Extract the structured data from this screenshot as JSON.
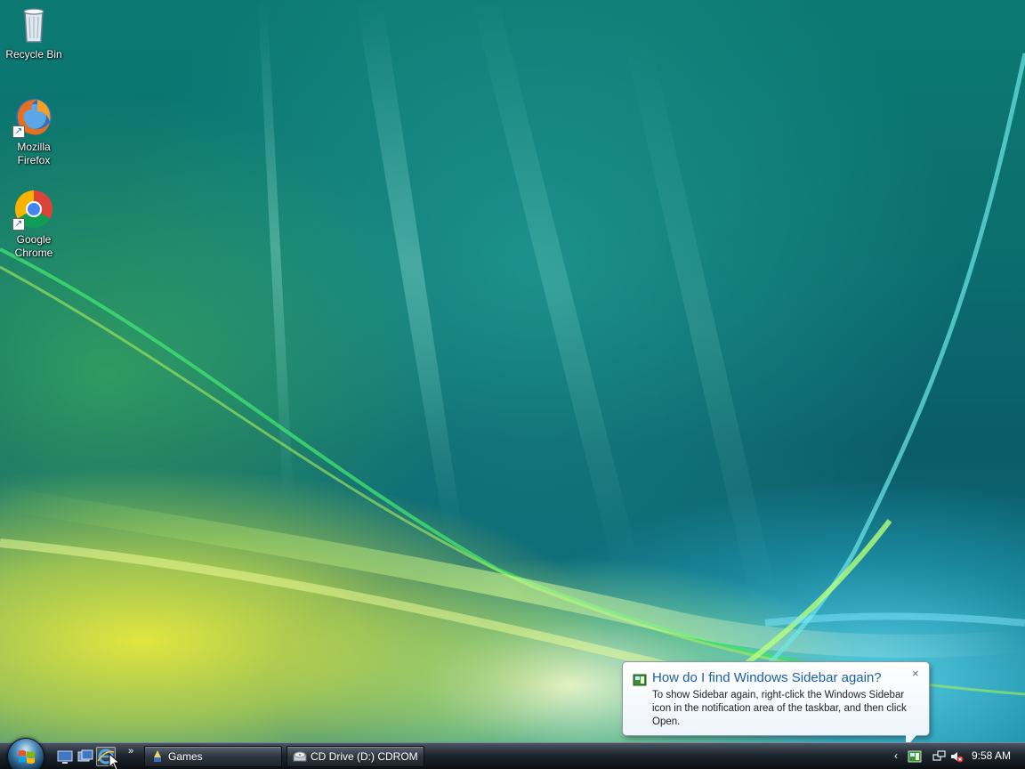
{
  "desktop": {
    "icons": [
      {
        "label": "Recycle Bin",
        "icon": "recycle-bin-icon"
      },
      {
        "label": "Mozilla Firefox",
        "icon": "firefox-icon",
        "shortcut": true
      },
      {
        "label": "Google Chrome",
        "icon": "chrome-icon",
        "shortcut": true
      }
    ]
  },
  "taskbar": {
    "start_icon": "windows-start-orb",
    "quicklaunch": [
      {
        "icon": "show-desktop-icon"
      },
      {
        "icon": "switch-windows-icon"
      },
      {
        "icon": "internet-explorer-icon",
        "active": true
      }
    ],
    "more": "»",
    "tasks": [
      {
        "label": "Games",
        "icon": "games-folder-icon"
      },
      {
        "label": "CD Drive (D:) CDROM",
        "icon": "cd-drive-icon"
      }
    ],
    "tray": {
      "expand": "‹",
      "icons": [
        "windows-sidebar-icon",
        "network-icon",
        "volume-muted-icon"
      ],
      "clock": "9:58 AM"
    }
  },
  "balloon": {
    "title": "How do I find Windows Sidebar again?",
    "text": "To show Sidebar again, right-click the Windows Sidebar icon in the notification area of the taskbar, and then click Open.",
    "close": "×"
  },
  "colors": {
    "balloon_title": "#1b5fa8",
    "taskbar": "#1f262e"
  }
}
